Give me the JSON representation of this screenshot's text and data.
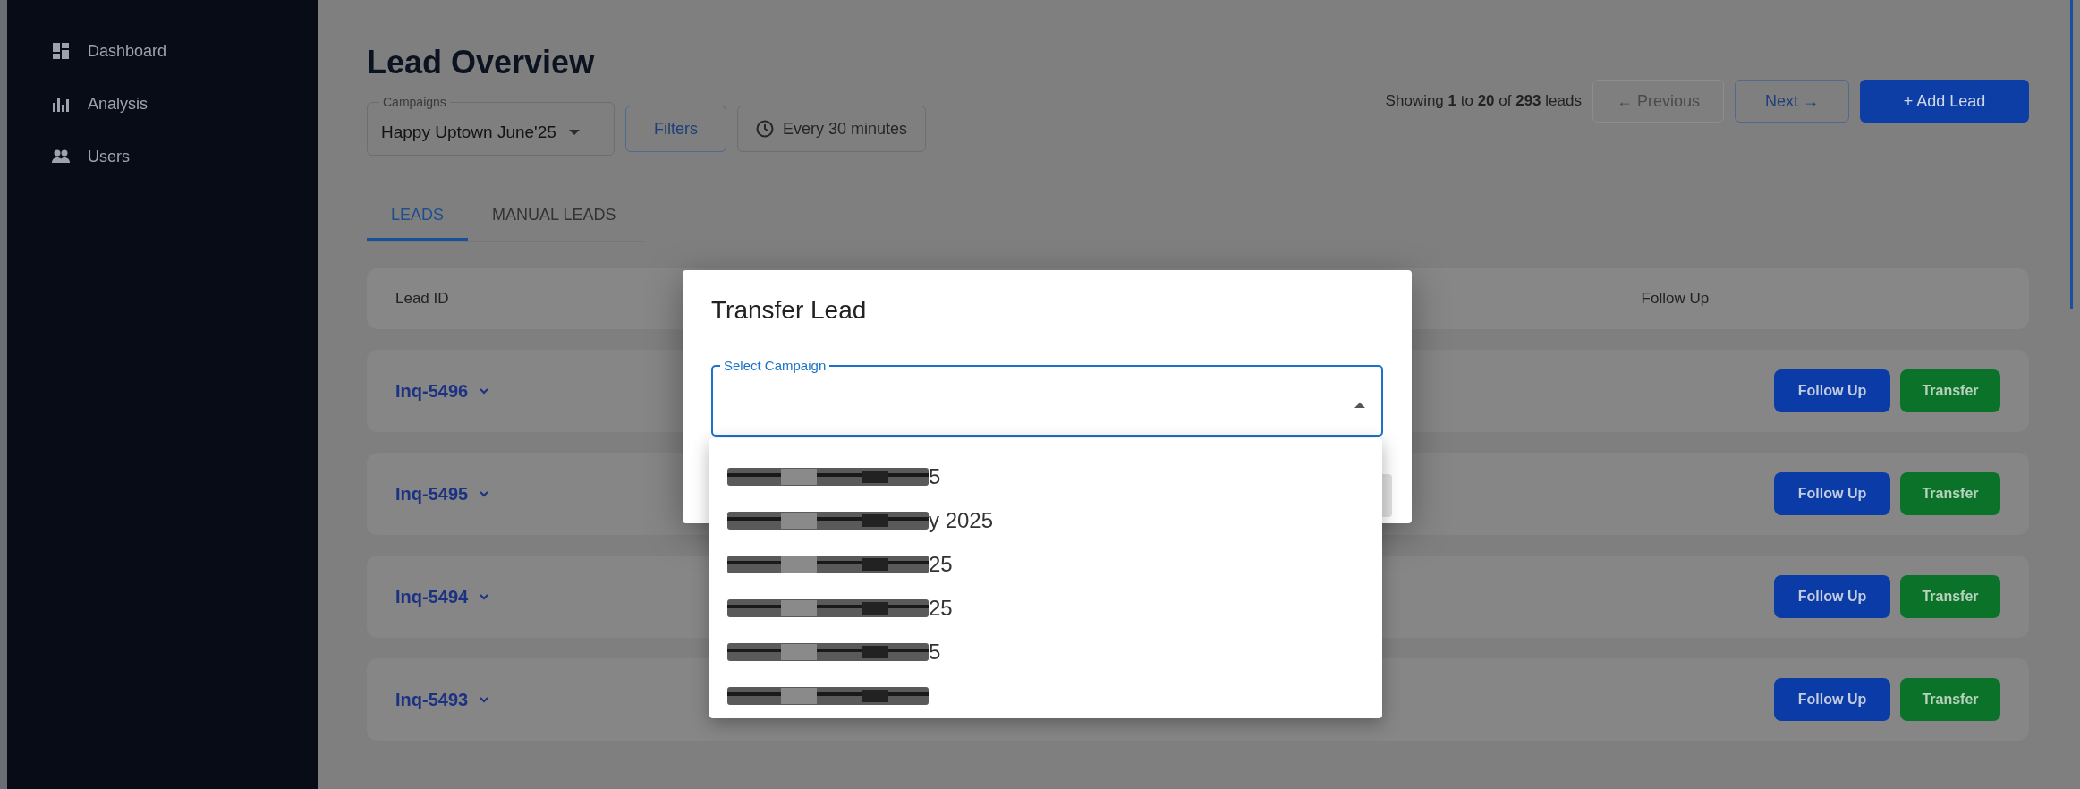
{
  "sidebar": {
    "items": [
      {
        "label": "Dashboard",
        "kind": "dashboard"
      },
      {
        "label": "Analysis",
        "kind": "chart"
      },
      {
        "label": "Users",
        "kind": "users"
      }
    ]
  },
  "header": {
    "title": "Lead Overview",
    "campaign_select": {
      "label": "Campaigns",
      "value": "Happy Uptown June'25"
    },
    "filters_button": "Filters",
    "refresh_button": "Every 30 minutes",
    "showing": "Showing **1** to **20** of **293** leads",
    "previous": {
      "label": "← Previous",
      "disabled": true
    },
    "next": {
      "label": "Next →",
      "disabled": false
    },
    "add_button": "+ Add Lead"
  },
  "tabs": [
    {
      "label": "LEADS",
      "selected": true
    },
    {
      "label": "MANUAL LEADS",
      "selected": false
    }
  ],
  "table": {
    "columns": [
      "Lead ID",
      "Follow Up"
    ],
    "rows": [
      {
        "lead_id": "Inq-5496",
        "actions": [
          "Follow Up",
          "Transfer"
        ]
      },
      {
        "lead_id": "Inq-5495",
        "actions": [
          "Follow Up",
          "Transfer"
        ]
      },
      {
        "lead_id": "Inq-5494",
        "actions": [
          "Follow Up",
          "Transfer"
        ]
      },
      {
        "lead_id": "Inq-5493",
        "actions": [
          "Follow Up",
          "Transfer"
        ]
      }
    ]
  },
  "dialog": {
    "title": "Transfer Lead",
    "select": {
      "label": "Select Campaign",
      "expanded": true
    },
    "options": [
      {
        "text": "5",
        "redacted": true
      },
      {
        "text": "y 2025",
        "redacted": true
      },
      {
        "text": "25",
        "redacted": true
      },
      {
        "text": "25",
        "redacted": true
      },
      {
        "text": "5",
        "redacted": true
      },
      {
        "redacted": true
      }
    ]
  }
}
